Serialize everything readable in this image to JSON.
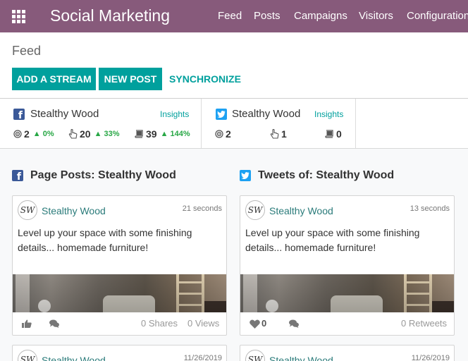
{
  "navbar": {
    "brand": "Social Marketing",
    "items": [
      "Feed",
      "Posts",
      "Campaigns",
      "Visitors",
      "Configuration"
    ],
    "color": "#875a7b"
  },
  "page": {
    "title": "Feed",
    "buttons": {
      "add_stream": "ADD A STREAM",
      "new_post": "NEW POST",
      "synchronize": "SYNCHRONIZE"
    },
    "accent": "#00a09d"
  },
  "accounts": [
    {
      "network": "facebook",
      "name": "Stealthy Wood",
      "insights": "Insights",
      "stats": {
        "audience": "2",
        "audience_trend": "0%",
        "engagement": "20",
        "engagement_trend": "33%",
        "stories": "39",
        "stories_trend": "144%"
      }
    },
    {
      "network": "twitter",
      "name": "Stealthy Wood",
      "insights": "Insights",
      "stats": {
        "audience": "2",
        "engagement": "1",
        "stories": "0"
      }
    }
  ],
  "streams": [
    {
      "title": "Page Posts: Stealthy Wood",
      "network": "facebook",
      "posts": [
        {
          "author": "Stealthy Wood",
          "time": "21 seconds",
          "message": "Level up your space with some finishing details... homemade furniture!",
          "shares": "0 Shares",
          "views": "0 Views"
        },
        {
          "author": "Stealthy Wood",
          "time": "11/26/2019"
        }
      ]
    },
    {
      "title": "Tweets of: Stealthy Wood",
      "network": "twitter",
      "posts": [
        {
          "author": "Stealthy Wood",
          "time": "13 seconds",
          "message": "Level up your space with some finishing details... homemade furniture!",
          "likes": "0",
          "retweets": "0 Retweets"
        },
        {
          "author": "Stealthy Wood",
          "time": "11/26/2019"
        }
      ]
    }
  ],
  "avatar_text": "SW",
  "icons": {
    "apps": "apps-grid-icon",
    "facebook": "facebook-icon",
    "twitter": "twitter-icon",
    "audience": "target-icon",
    "engagement": "pointer-hand-icon",
    "stories": "book-icon",
    "like": "thumbs-up-icon",
    "comment": "comments-icon",
    "heart": "heart-icon"
  }
}
